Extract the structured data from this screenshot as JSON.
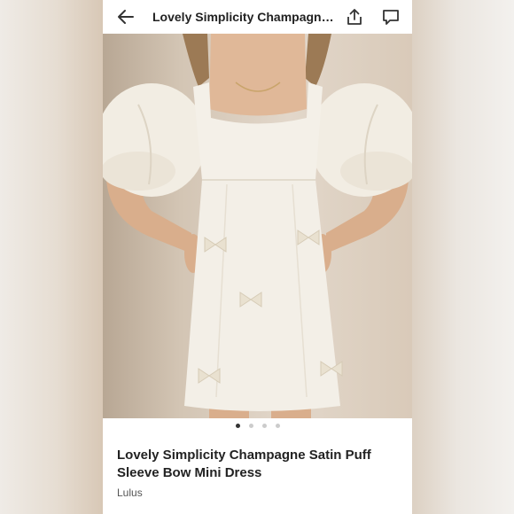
{
  "header": {
    "title": "Lovely Simplicity Champagne Satin Puff Sleeve Bow Mini Dress",
    "icons": {
      "back": "back-arrow-icon",
      "share": "share-icon",
      "comment": "comment-icon"
    }
  },
  "gallery": {
    "image_description_icon": "product-photo",
    "page_count": 4,
    "active_index": 0
  },
  "product": {
    "name": "Lovely Simplicity Champagne Satin Puff Sleeve Bow Mini Dress",
    "brand": "Lulus"
  },
  "colors": {
    "accent": "#222222",
    "background": "#ffffff"
  }
}
